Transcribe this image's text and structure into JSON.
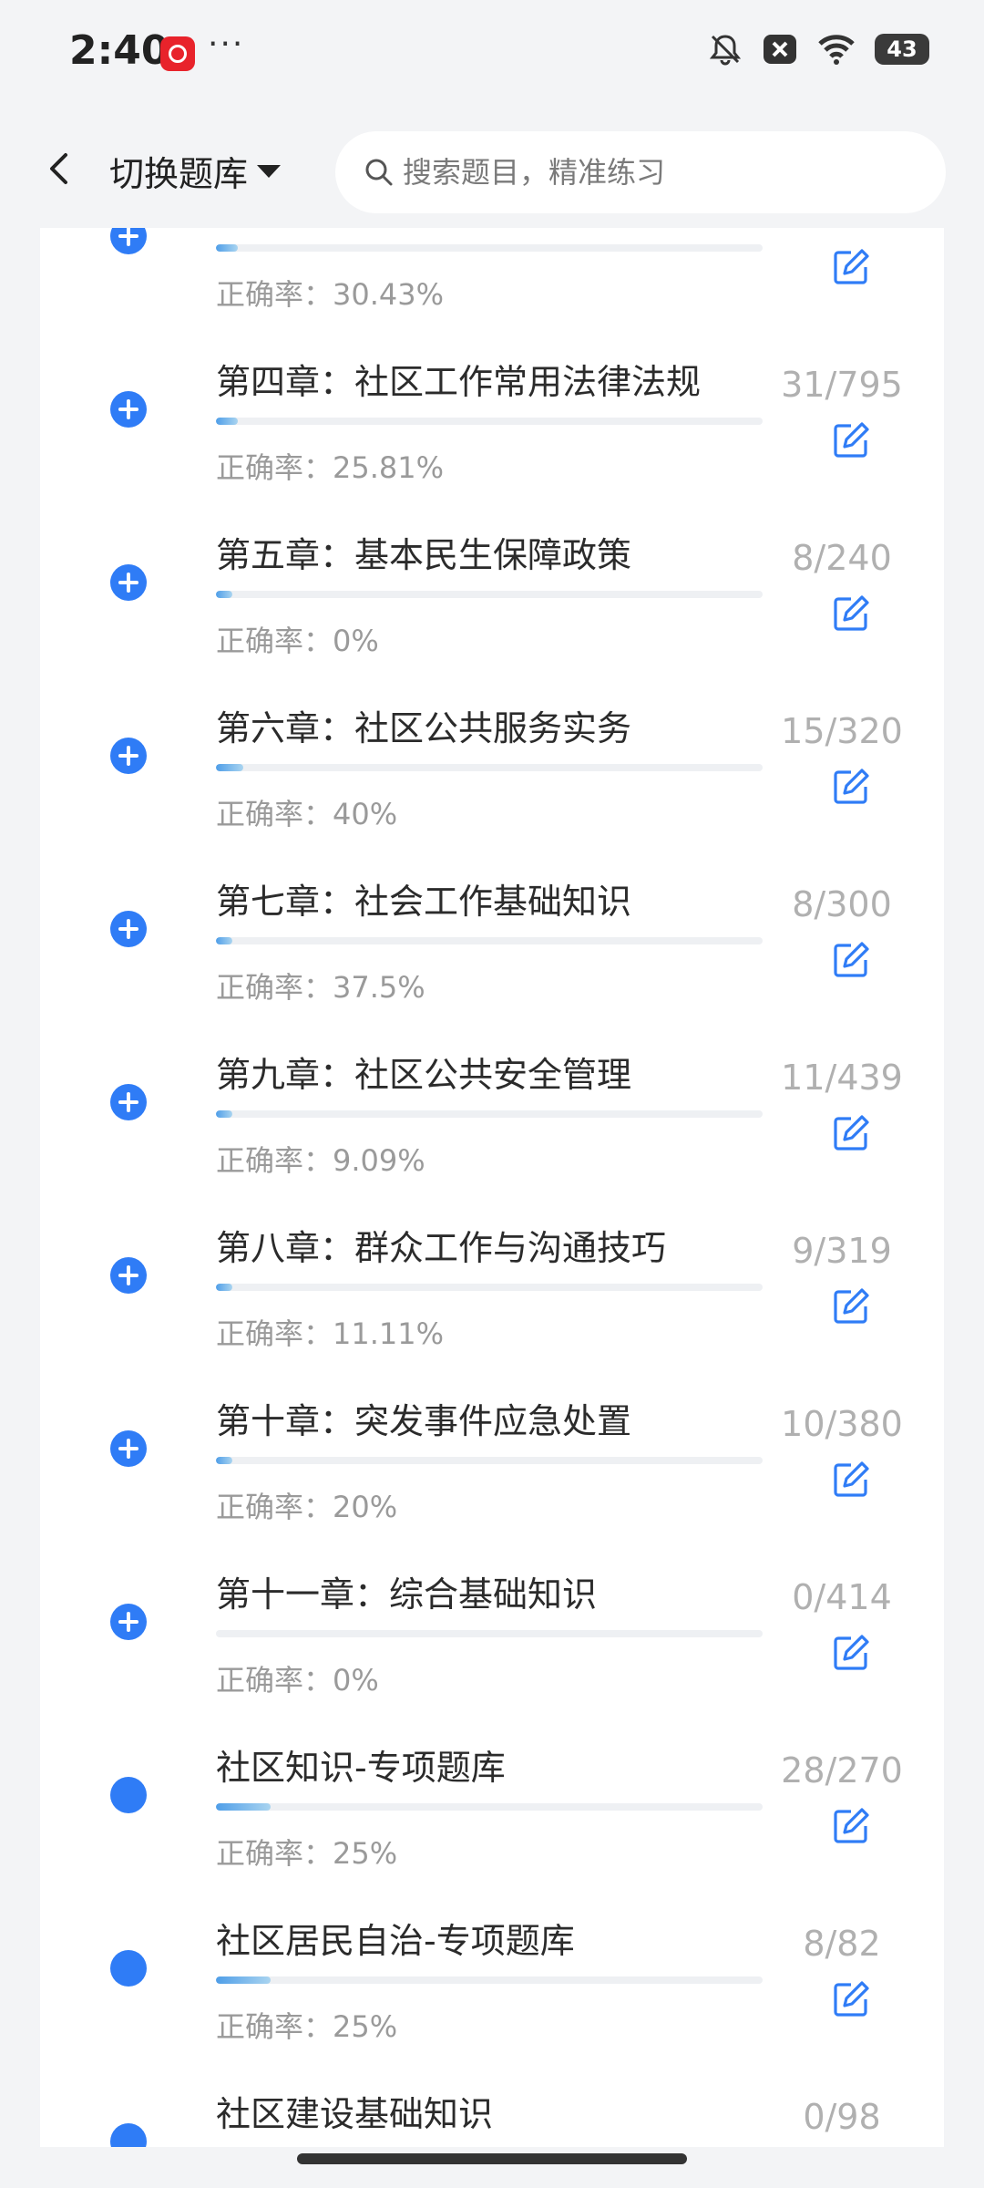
{
  "status_bar": {
    "time": "2:40",
    "app_icon": "netease-music-icon",
    "more": "···",
    "icons": [
      "bell-muted-icon",
      "close-box-icon",
      "wifi-icon",
      "battery-icon"
    ],
    "battery": "43"
  },
  "header": {
    "back_icon": "chevron-left-icon",
    "switch_label": "切换题库",
    "search_placeholder": "搜索题目，精准练习"
  },
  "accuracy_label": "正确率：",
  "rows": [
    {
      "title": "",
      "accuracy": "30.43%",
      "count": "",
      "progress": 0.04,
      "icon": "plus"
    },
    {
      "title": "第四章：社区工作常用法律法规",
      "accuracy": "25.81%",
      "count": "31/795",
      "progress": 0.04,
      "icon": "plus"
    },
    {
      "title": "第五章：基本民生保障政策",
      "accuracy": "0%",
      "count": "8/240",
      "progress": 0.03,
      "icon": "plus"
    },
    {
      "title": "第六章：社区公共服务实务",
      "accuracy": "40%",
      "count": "15/320",
      "progress": 0.05,
      "icon": "plus"
    },
    {
      "title": "第七章：社会工作基础知识",
      "accuracy": "37.5%",
      "count": "8/300",
      "progress": 0.03,
      "icon": "plus"
    },
    {
      "title": "第九章：社区公共安全管理",
      "accuracy": "9.09%",
      "count": "11/439",
      "progress": 0.03,
      "icon": "plus"
    },
    {
      "title": "第八章：群众工作与沟通技巧",
      "accuracy": "11.11%",
      "count": "9/319",
      "progress": 0.03,
      "icon": "plus"
    },
    {
      "title": "第十章：突发事件应急处置",
      "accuracy": "20%",
      "count": "10/380",
      "progress": 0.03,
      "icon": "plus"
    },
    {
      "title": "第十一章：综合基础知识",
      "accuracy": "0%",
      "count": "0/414",
      "progress": 0.0,
      "icon": "plus"
    },
    {
      "title": "社区知识-专项题库",
      "accuracy": "25%",
      "count": "28/270",
      "progress": 0.1,
      "icon": "dot"
    },
    {
      "title": "社区居民自治-专项题库",
      "accuracy": "25%",
      "count": "8/82",
      "progress": 0.1,
      "icon": "dot"
    },
    {
      "title": "社区建设基础知识",
      "accuracy": "",
      "count": "0/98",
      "progress": 0.0,
      "icon": "dot"
    }
  ],
  "colors": {
    "accent": "#2f7cf6",
    "progress": "#4f9ee8",
    "muted_text": "#9a9a9a",
    "count_text": "#b0b0b0"
  }
}
